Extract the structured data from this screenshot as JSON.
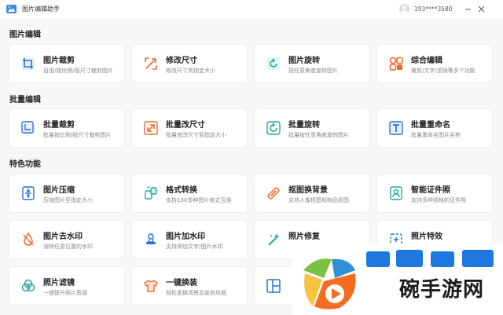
{
  "app": {
    "title": "图片编辑助手",
    "user_phone": "193****3580",
    "icons": {
      "logo": "image-editor-logo",
      "minimize": "minimize-icon",
      "close": "close-icon"
    }
  },
  "sections": [
    {
      "title": "图片编辑",
      "items": [
        {
          "title": "图片裁剪",
          "desc": "自由/按比例/按尺寸裁剪图片",
          "icon": "crop-icon"
        },
        {
          "title": "修改尺寸",
          "desc": "修改尺寸到指定大小",
          "icon": "resize-icon"
        },
        {
          "title": "图片旋转",
          "desc": "按任意角度旋转图片",
          "icon": "rotate-icon"
        },
        {
          "title": "综合编辑",
          "desc": "裁剪/文字/滤镜等多个功能",
          "icon": "grid-edit-icon"
        }
      ]
    },
    {
      "title": "批量编辑",
      "items": [
        {
          "title": "批量裁剪",
          "desc": "批量按比例/按尺寸裁剪图片",
          "icon": "batch-crop-icon"
        },
        {
          "title": "批量改尺寸",
          "desc": "批量修改尺寸到指定大小",
          "icon": "batch-resize-icon"
        },
        {
          "title": "批量旋转",
          "desc": "批量按任意角度旋转图片",
          "icon": "batch-rotate-icon"
        },
        {
          "title": "批量重命名",
          "desc": "批量重命名图片名称",
          "icon": "rename-icon"
        }
      ]
    },
    {
      "title": "特色功能",
      "items": [
        {
          "title": "图片压缩",
          "desc": "压缩图片至指定大小",
          "icon": "compress-icon"
        },
        {
          "title": "格式转换",
          "desc": "支持100多种图片格式互换",
          "icon": "convert-icon"
        },
        {
          "title": "抠图换背景",
          "desc": "支持人像抠图和物品抠图",
          "icon": "cutout-icon"
        },
        {
          "title": "智能证件照",
          "desc": "支持多种规格的证件照",
          "icon": "id-photo-icon"
        },
        {
          "title": "图片去水印",
          "desc": "消除任意位置的水印",
          "icon": "remove-watermark-icon"
        },
        {
          "title": "图片加水印",
          "desc": "支持添加文字/图片水印",
          "icon": "add-watermark-icon"
        },
        {
          "title": "照片修复",
          "desc": "",
          "icon": "magic-wand-icon"
        },
        {
          "title": "照片特效",
          "desc": "",
          "icon": "effects-icon"
        },
        {
          "title": "照片滤镜",
          "desc": "一键提升照片质感",
          "icon": "filter-icon"
        },
        {
          "title": "一键换装",
          "desc": "轻松更换场景及装扮风格",
          "icon": "clothing-icon"
        },
        {
          "title": "",
          "desc": "",
          "icon": "layout-icon"
        }
      ]
    }
  ],
  "watermark": {
    "text": "碗手游网",
    "logo": "watermark-logo"
  },
  "colors": {
    "accent": "#2c7be5",
    "icon_blue": "#2b73d6",
    "icon_orange": "#f06c2e",
    "icon_teal": "#22a6a0"
  }
}
